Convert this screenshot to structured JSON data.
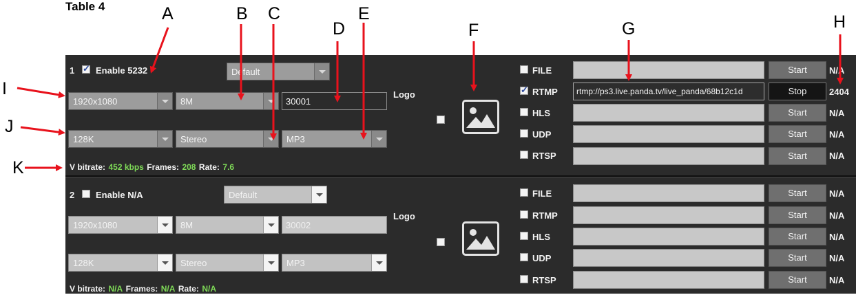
{
  "caption": "Table 4",
  "callouts": [
    "A",
    "B",
    "C",
    "D",
    "E",
    "F",
    "G",
    "H",
    "I",
    "J",
    "K"
  ],
  "channels": [
    {
      "number": "1",
      "enable_label": "Enable 5232",
      "enabled": true,
      "preset": "Default",
      "resolution": "1920x1080",
      "video_bitrate": "8M",
      "port": "30001",
      "audio_bitrate": "128K",
      "audio_channels": "Stereo",
      "audio_codec": "MP3",
      "logo_label": "Logo",
      "stats": {
        "vbitrate_label": "V bitrate:",
        "vbitrate": "452 kbps",
        "frames_label": "Frames:",
        "frames": "208",
        "rate_label": "Rate:",
        "rate": "7.6"
      },
      "outputs": [
        {
          "label": "FILE",
          "checked": false,
          "url": "",
          "button": "Start",
          "status": "N/A"
        },
        {
          "label": "RTMP",
          "checked": true,
          "url": "rtmp://ps3.live.panda.tv/live_panda/68b12c1d",
          "button": "Stop",
          "status": "2404"
        },
        {
          "label": "HLS",
          "checked": false,
          "url": "",
          "button": "Start",
          "status": "N/A"
        },
        {
          "label": "UDP",
          "checked": false,
          "url": "",
          "button": "Start",
          "status": "N/A"
        },
        {
          "label": "RTSP",
          "checked": false,
          "url": "",
          "button": "Start",
          "status": "N/A"
        }
      ]
    },
    {
      "number": "2",
      "enable_label": "Enable N/A",
      "enabled": false,
      "preset": "Default",
      "resolution": "1920x1080",
      "video_bitrate": "8M",
      "port": "30002",
      "audio_bitrate": "128K",
      "audio_channels": "Stereo",
      "audio_codec": "MP3",
      "logo_label": "Logo",
      "stats": {
        "vbitrate_label": "V bitrate:",
        "vbitrate": "N/A",
        "frames_label": "Frames:",
        "frames": "N/A",
        "rate_label": "Rate:",
        "rate": "N/A"
      },
      "outputs": [
        {
          "label": "FILE",
          "checked": false,
          "url": "",
          "button": "Start",
          "status": "N/A"
        },
        {
          "label": "RTMP",
          "checked": false,
          "url": "",
          "button": "Start",
          "status": "N/A"
        },
        {
          "label": "HLS",
          "checked": false,
          "url": "",
          "button": "Start",
          "status": "N/A"
        },
        {
          "label": "UDP",
          "checked": false,
          "url": "",
          "button": "Start",
          "status": "N/A"
        },
        {
          "label": "RTSP",
          "checked": false,
          "url": "",
          "button": "Start",
          "status": "N/A"
        }
      ]
    }
  ],
  "colors": {
    "panel": "#2b2b2b",
    "stat_green": "#7ed957",
    "callout_arrow": "#e8121c"
  }
}
